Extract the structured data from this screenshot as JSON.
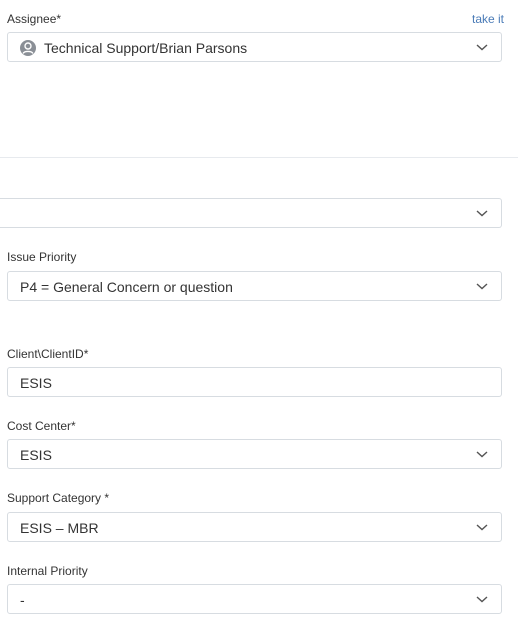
{
  "assignee": {
    "label": "Assignee*",
    "take_it": "take it",
    "value": "Technical Support/Brian Parsons",
    "icon": "user-avatar-icon"
  },
  "unlabeled_select": {
    "value": ""
  },
  "issue_priority": {
    "label": "Issue Priority",
    "value": "P4 = General Concern or question"
  },
  "client_id": {
    "label": "Client\\ClientID*",
    "value": "ESIS"
  },
  "cost_center": {
    "label": "Cost Center*",
    "value": "ESIS"
  },
  "support_category": {
    "label": "Support Category *",
    "value": "ESIS – MBR"
  },
  "internal_priority": {
    "label": "Internal Priority",
    "value": "-"
  },
  "colors": {
    "link": "#4a7bb7",
    "border": "#d7dce1",
    "text": "#333333"
  }
}
